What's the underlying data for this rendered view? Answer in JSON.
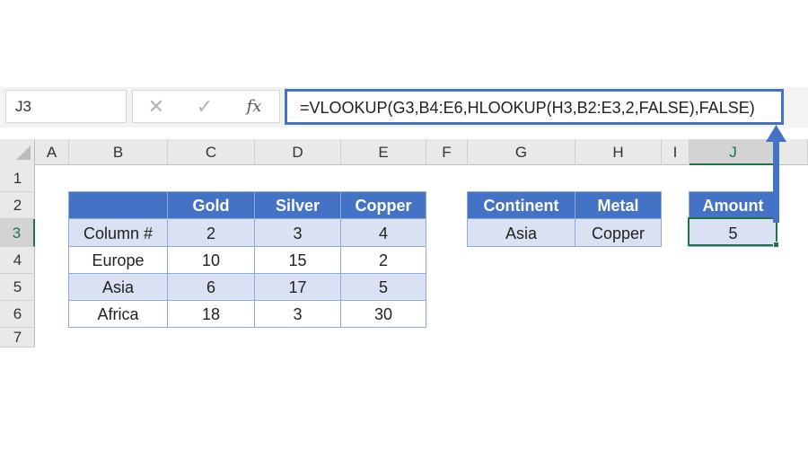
{
  "formula_bar": {
    "name_box": "J3",
    "cancel_icon": "✕",
    "enter_icon": "✓",
    "fx_label": "fx",
    "formula": "=VLOOKUP(G3,B4:E6,HLOOKUP(H3,B2:E3,2,FALSE),FALSE)"
  },
  "columns": [
    "A",
    "B",
    "C",
    "D",
    "E",
    "F",
    "G",
    "H",
    "I",
    "J"
  ],
  "selected_column": "J",
  "rows": [
    "1",
    "2",
    "3",
    "4",
    "5",
    "6",
    "7"
  ],
  "selected_row": "3",
  "lookup_table": {
    "headers": [
      "",
      "Gold",
      "Silver",
      "Copper"
    ],
    "rows": [
      [
        "Column #",
        "2",
        "3",
        "4"
      ],
      [
        "Europe",
        "10",
        "15",
        "2"
      ],
      [
        "Asia",
        "6",
        "17",
        "5"
      ],
      [
        "Africa",
        "18",
        "3",
        "30"
      ]
    ]
  },
  "input_table": {
    "headers": [
      "Continent",
      "Metal"
    ],
    "values": [
      "Asia",
      "Copper"
    ]
  },
  "result_table": {
    "header": "Amount",
    "value": "5"
  },
  "colors": {
    "header_fill": "#4472c4",
    "band_fill": "#d9e1f2",
    "selection": "#217346",
    "arrow": "#4472c4"
  }
}
